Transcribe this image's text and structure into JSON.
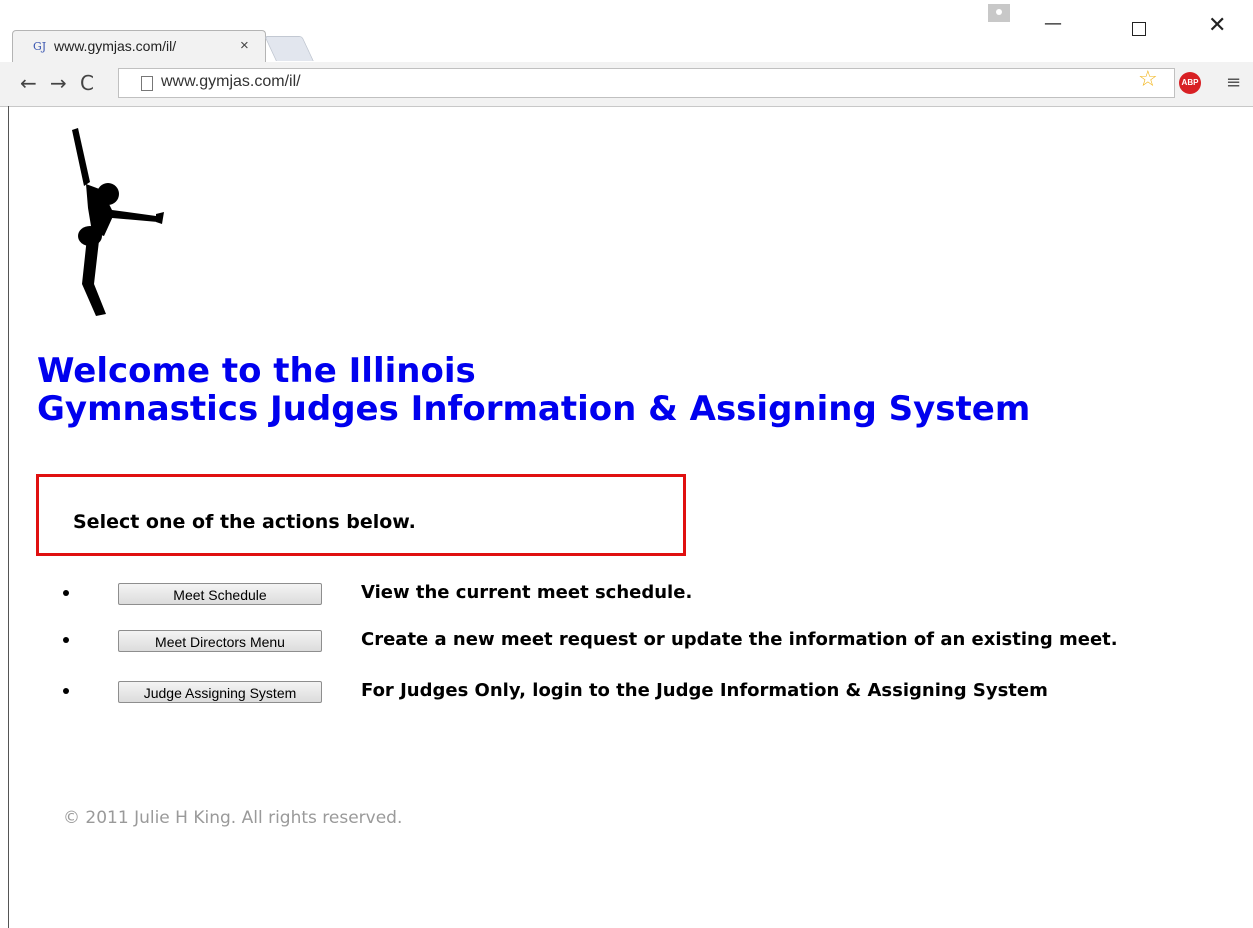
{
  "browser": {
    "tab": {
      "favicon": "GJ",
      "title": "www.gymjas.com/il/",
      "close": "×"
    },
    "address_bar": {
      "url": "www.gymjas.com/il/"
    },
    "nav": {
      "back": "←",
      "forward": "→",
      "reload": "C"
    },
    "extensions": {
      "star": "☆",
      "abp": "ABP",
      "menu": "≡"
    },
    "window_controls": {
      "minimize": "—",
      "close": "✕"
    }
  },
  "page": {
    "heading": {
      "line1": "Welcome to the Illinois",
      "line2": "Gymnastics Judges Information & Assigning System"
    },
    "instruction": "Select one of the actions below.",
    "actions": [
      {
        "button": "Meet Schedule",
        "description": "View the current meet schedule."
      },
      {
        "button": "Meet Directors Menu",
        "description": "Create a new meet request or update the information of an existing meet."
      },
      {
        "button": "Judge Assigning System",
        "description": "For Judges Only, login to the Judge Information & Assigning System"
      }
    ],
    "footer": "© 2011 Julie H King. All rights reserved."
  },
  "colors": {
    "heading": "#0000ee",
    "box_border": "#e01010",
    "footer_text": "#9a9a9a"
  }
}
